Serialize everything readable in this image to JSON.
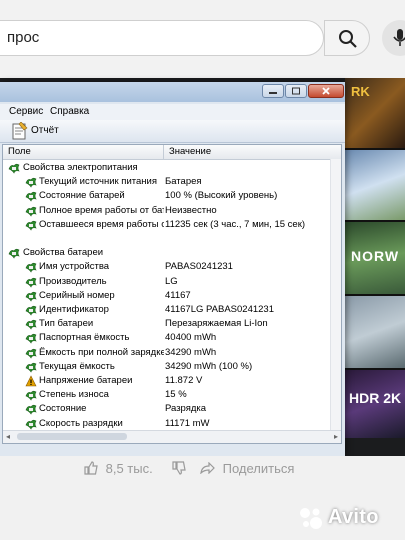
{
  "browser": {
    "search_value": "прос"
  },
  "dialog": {
    "menu": [
      "Сервис",
      "Справка"
    ],
    "toolbar_report": "Отчёт",
    "columns": {
      "field": "Поле",
      "value": "Значение"
    },
    "rows": [
      {
        "kind": "group",
        "field": "Свойства электропитания",
        "value": ""
      },
      {
        "kind": "item",
        "field": "Текущий источник питания",
        "value": "Батарея"
      },
      {
        "kind": "item",
        "field": "Состояние батарей",
        "value": "100 % (Высокий уровень)"
      },
      {
        "kind": "item",
        "field": "Полное время работы от бата...",
        "value": "Неизвестно"
      },
      {
        "kind": "item",
        "field": "Оставшееся время работы от ...",
        "value": "11235 сек (3 час., 7 мин, 15 сек)"
      },
      {
        "kind": "blank",
        "field": "",
        "value": ""
      },
      {
        "kind": "group",
        "field": "Свойства батареи",
        "value": ""
      },
      {
        "kind": "item",
        "field": "Имя устройства",
        "value": "PABAS0241231"
      },
      {
        "kind": "item",
        "field": "Производитель",
        "value": "LG"
      },
      {
        "kind": "item",
        "field": "Серийный номер",
        "value": "41167"
      },
      {
        "kind": "item",
        "field": "Идентификатор",
        "value": "41167LG PABAS0241231"
      },
      {
        "kind": "item",
        "field": "Тип батареи",
        "value": "Перезаряжаемая Li-Ion"
      },
      {
        "kind": "item",
        "field": "Паспортная ёмкость",
        "value": "40400 mWh"
      },
      {
        "kind": "item",
        "field": "Ёмкость при полной зарядке",
        "value": "34290 mWh"
      },
      {
        "kind": "item",
        "field": "Текущая ёмкость",
        "value": "34290 mWh  (100 %)"
      },
      {
        "kind": "warn",
        "field": "Напряжение батареи",
        "value": "11.872 V"
      },
      {
        "kind": "item",
        "field": "Степень износа",
        "value": "15 %"
      },
      {
        "kind": "item",
        "field": "Состояние",
        "value": "Разрядка"
      },
      {
        "kind": "item",
        "field": "Скорость разрядки",
        "value": "11171 mW"
      }
    ]
  },
  "video": {
    "likes": "8,5 тыс.",
    "share": "Поделиться"
  },
  "thumbnails": [
    "RK",
    "NORW",
    "HDR 2K"
  ],
  "watermark": "Avito",
  "colors": {
    "group_icon": "#2e8b2e",
    "warn_icon": "#e0a000"
  }
}
